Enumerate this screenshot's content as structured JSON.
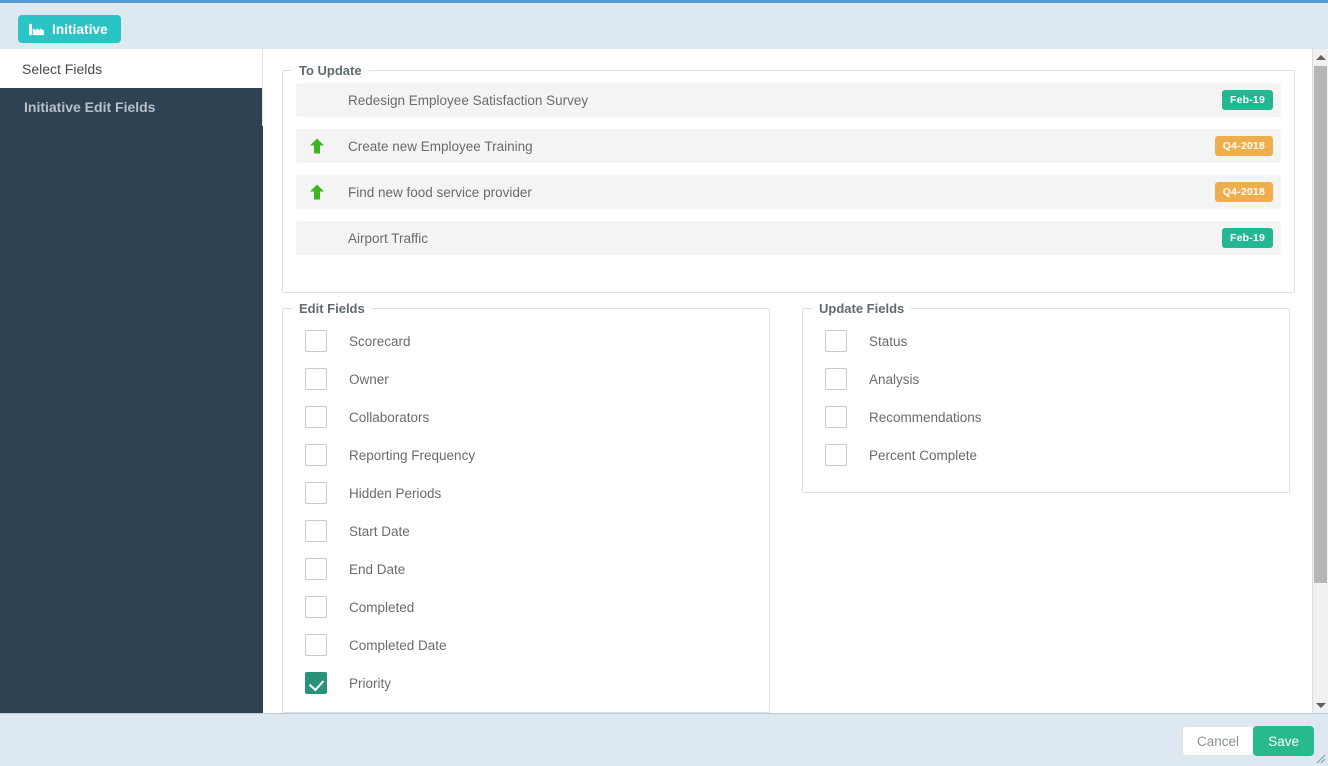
{
  "header": {
    "badge": {
      "label": "Initiative",
      "icon": "industry-icon",
      "bg": "#2ac4c4"
    }
  },
  "sidebar": {
    "header_label": "Select Fields",
    "items": [
      {
        "label": "Initiative Edit Fields",
        "active": true
      }
    ]
  },
  "to_update": {
    "legend": "To Update",
    "rows": [
      {
        "title": "Redesign Employee Satisfaction Survey",
        "icon": "yellow-square-icon",
        "icon_color": "#fad331",
        "badge": "Feb-19",
        "badge_color": "#23b893"
      },
      {
        "title": "Create new Employee Training",
        "icon": "green-up-arrow-icon",
        "icon_color": "#3cb521",
        "badge": "Q4-2018",
        "badge_color": "#f0a košer"
      },
      {
        "title": "Find new food service provider",
        "icon": "green-up-arrow-icon",
        "icon_color": "#3cb521",
        "badge": "Q4-2018",
        "badge_color": "#f0ad4e"
      },
      {
        "title": "Airport Traffic",
        "icon": "yellow-square-icon",
        "icon_color": "#fad331",
        "badge": "Feb-19",
        "badge_color": "#23b893"
      }
    ]
  },
  "edit_fields": {
    "legend": "Edit Fields",
    "items": [
      {
        "label": "Scorecard",
        "checked": false
      },
      {
        "label": "Owner",
        "checked": false
      },
      {
        "label": "Collaborators",
        "checked": false
      },
      {
        "label": "Reporting Frequency",
        "checked": false
      },
      {
        "label": "Hidden Periods",
        "checked": false
      },
      {
        "label": "Start Date",
        "checked": false
      },
      {
        "label": "End Date",
        "checked": false
      },
      {
        "label": "Completed",
        "checked": false
      },
      {
        "label": "Completed Date",
        "checked": false
      },
      {
        "label": "Priority",
        "checked": true
      }
    ]
  },
  "update_fields": {
    "legend": "Update Fields",
    "items": [
      {
        "label": "Status",
        "checked": false
      },
      {
        "label": "Analysis",
        "checked": false
      },
      {
        "label": "Recommendations",
        "checked": false
      },
      {
        "label": "Percent Complete",
        "checked": false
      }
    ]
  },
  "footer": {
    "cancel_label": "Cancel",
    "save_label": "Save",
    "save_color": "#28b98e"
  },
  "scrollbar": {
    "up_icon": "caret-up-icon",
    "down_icon": "caret-down-icon"
  }
}
